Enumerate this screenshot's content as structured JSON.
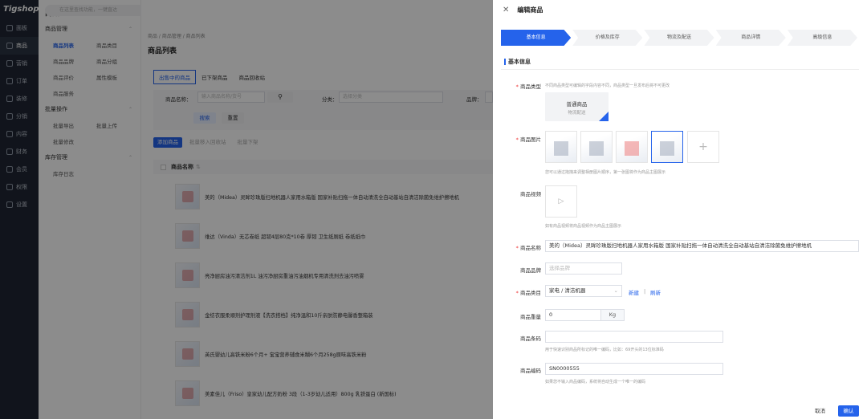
{
  "app": {
    "logo": "Tigshop",
    "search_placeholder": "在这里查找功能，一键直达"
  },
  "nav": [
    "面板",
    "商品",
    "营销",
    "订单",
    "装修",
    "分销",
    "内容",
    "财务",
    "会员",
    "权限",
    "设置"
  ],
  "sub": {
    "title": "商品",
    "groups": [
      {
        "label": "商品管理",
        "rows": [
          [
            "商品列表",
            "商品类目"
          ],
          [
            "商品品牌",
            "商品分组"
          ],
          [
            "商品评价",
            "属性模板"
          ],
          [
            "商品服务",
            ""
          ]
        ]
      },
      {
        "label": "批量操作",
        "rows": [
          [
            "批量导出",
            "批量上传"
          ],
          [
            "批量修改",
            ""
          ]
        ]
      },
      {
        "label": "库存管理",
        "rows": [
          [
            "库存日志",
            ""
          ]
        ]
      }
    ]
  },
  "main": {
    "breadcrumb": "商品 / 商品管理 / 商品列表",
    "title": "商品列表",
    "tabs": [
      "出售中的商品",
      "已下架商品",
      "商品回收站"
    ],
    "filter": {
      "name_label": "商品名称：",
      "name_placeholder": "输入商品名称/货号",
      "cat_label": "分类：",
      "cat_placeholder": "选择分类",
      "brand_label": "品牌：",
      "search": "搜索",
      "reset": "重置"
    },
    "actions": [
      "添加商品",
      "批量移入回收站",
      "批量下架"
    ],
    "col_name": "商品名称",
    "products": [
      "美的（Midea）灵眸珍珠版扫地机器人家用水箱版 国家补贴扫拖一体自动清洗全自动基站自清洁除菌免维护擦地机",
      "维达（Vinda）无芯卷纸 超韧4层80克*10卷 厚韧 卫生纸厕纸 卷纸纸巾",
      "亮净厨房油污清洁剂1L 油污净厨房重油污油烟机专用清洗剂去油污喷雾",
      "金纺衣服柔顺剂护理剂液【洗衣搭档】纯净温和10斤亲肤防静电馨香整箱装",
      "英氏婴幼儿高铁米粉6个月+ 宝宝营养辅食米糊6个月258g原味高铁米粉",
      "美素佳儿（Friso）皇家幼儿配方奶粉 3段（1-3岁幼儿适用）800g 乳铁蛋白 (新国标)"
    ]
  },
  "drawer": {
    "title": "编辑商品",
    "steps": [
      "基本信息",
      "价格及库存",
      "物流及配送",
      "商品详情",
      "高级信息"
    ],
    "section": "基本信息",
    "type": {
      "label": "商品类型",
      "hint": "不同商品类型可编辑的字段内容不同，商品类型一旦发布后将不可更改",
      "card_title": "普通商品",
      "card_sub": "物流配送"
    },
    "images": {
      "label": "商品图片",
      "hint": "您可以通过拖拽来调整相册图片顺序，第一张图将作为商品主图展示",
      "add": "+"
    },
    "video": {
      "label": "商品视频",
      "hint": "如有商品视频将商品视频作为商品主图展示",
      "icon": "▷"
    },
    "name": {
      "label": "商品名称",
      "value": "美的（Midea）灵眸珍珠版扫地机器人家用水箱版 国家补贴扫拖一体自动清洗全自动基站自清洁除菌免维护擦地机"
    },
    "brand": {
      "label": "商品品牌",
      "placeholder": "选择品牌"
    },
    "category": {
      "label": "商品类目",
      "value": "家电 / 清洁机器",
      "new": "新建",
      "sep": "|",
      "refresh": "刷新"
    },
    "weight": {
      "label": "商品重量",
      "value": "0",
      "unit": "Kg"
    },
    "barcode": {
      "label": "商品条码",
      "value": "",
      "hint": "用于快速识别商品所标记的唯一编码，比如：69开头的13位标准码"
    },
    "sn": {
      "label": "商品编码",
      "value": "SN0000555",
      "hint": "如果您不输入商品编码，系统将自动生成一个唯一的编码"
    },
    "cancel": "取消",
    "confirm": "确认"
  },
  "colors": {
    "primary": "#2563eb",
    "nav_bg": "#1f2633"
  }
}
